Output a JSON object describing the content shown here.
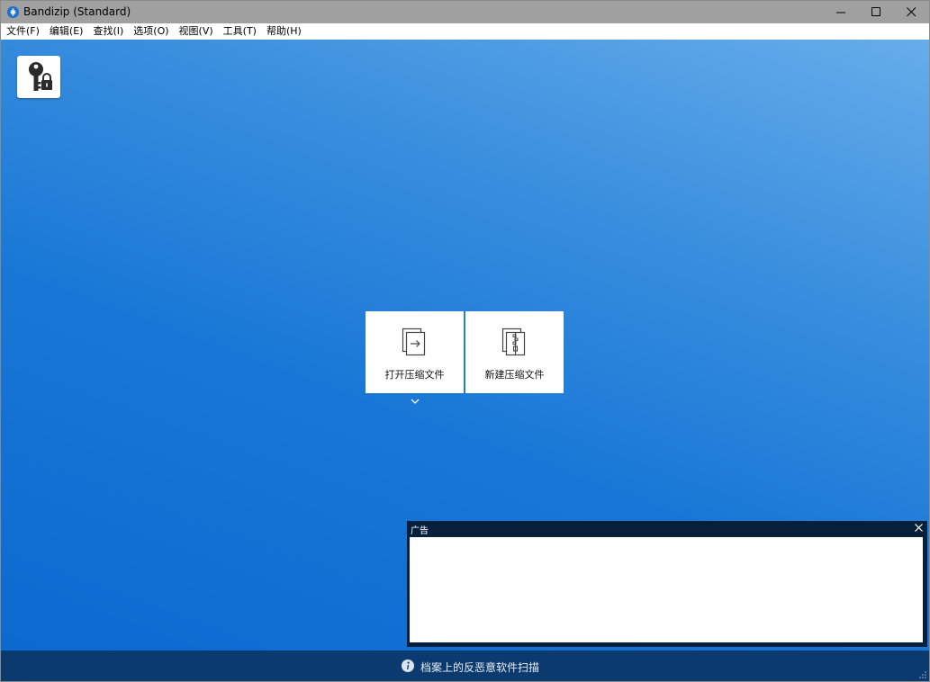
{
  "window": {
    "title": "Bandizip (Standard)"
  },
  "menu": [
    {
      "label": "文件(F)"
    },
    {
      "label": "编辑(E)"
    },
    {
      "label": "查找(I)"
    },
    {
      "label": "选项(O)"
    },
    {
      "label": "视图(V)"
    },
    {
      "label": "工具(T)"
    },
    {
      "label": "帮助(H)"
    }
  ],
  "main": {
    "key_button_icon": "key-lock-icon",
    "tiles": [
      {
        "label": "打开压缩文件",
        "icon": "open-archive-icon"
      },
      {
        "label": "新建压缩文件",
        "icon": "new-archive-icon"
      }
    ]
  },
  "ad": {
    "title": "广告"
  },
  "statusbar": {
    "text": "档案上的反恶意软件扫描"
  },
  "colors": {
    "titlebar": "#a0a0a0",
    "main_gradient_top_right": "#66adea",
    "main_gradient_bottom_left": "#0a6ad0",
    "ad_frame": "#06203c",
    "statusbar": "#0b3a6e"
  }
}
